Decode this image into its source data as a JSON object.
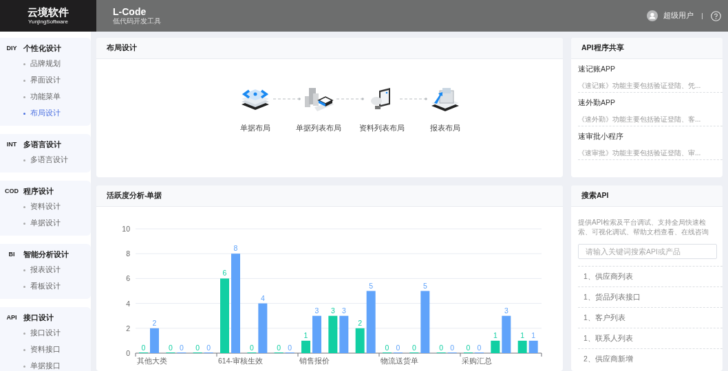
{
  "brand": {
    "name": "云境软件",
    "subtitle": "YunjingSoftware"
  },
  "app": {
    "title": "L-Code",
    "subtitle": "低代码开发工具"
  },
  "user": {
    "name": "超级用户"
  },
  "sidebar": {
    "groups": [
      {
        "code": "DIY",
        "title": "个性化设计",
        "items": [
          {
            "label": "品牌规划",
            "selected": false
          },
          {
            "label": "界面设计",
            "selected": false
          },
          {
            "label": "功能菜单",
            "selected": false
          },
          {
            "label": "布局设计",
            "selected": true
          }
        ]
      },
      {
        "code": "INT",
        "title": "多语言设计",
        "items": [
          {
            "label": "多语言设计",
            "selected": false
          }
        ]
      },
      {
        "code": "COD",
        "title": "程序设计",
        "items": [
          {
            "label": "资料设计",
            "selected": false
          },
          {
            "label": "单据设计",
            "selected": false
          }
        ]
      },
      {
        "code": "BI",
        "title": "智能分析设计",
        "items": [
          {
            "label": "报表设计",
            "selected": false
          },
          {
            "label": "看板设计",
            "selected": false
          }
        ]
      },
      {
        "code": "API",
        "title": "接口设计",
        "items": [
          {
            "label": "接口设计",
            "selected": false
          },
          {
            "label": "资料接口",
            "selected": false
          },
          {
            "label": "单据接口",
            "selected": false
          }
        ]
      }
    ]
  },
  "layout_panel": {
    "title": "布局设计",
    "steps": [
      {
        "kind": "stack",
        "label": "单据布局"
      },
      {
        "kind": "buildings",
        "label": "单据列表布局"
      },
      {
        "kind": "monitor",
        "label": "资料列表布局"
      },
      {
        "kind": "machine",
        "label": "报表布局"
      }
    ]
  },
  "activity_panel": {
    "title": "活跃度分析-单据",
    "chart_data": {
      "type": "bar",
      "categories": [
        "其他大类",
        null,
        null,
        "614-审核生效",
        null,
        null,
        "销售报价",
        null,
        null,
        "物流送货单",
        null,
        null,
        "采购汇总",
        null,
        null
      ],
      "series": [
        {
          "color": "#12cfa3",
          "values": [
            0,
            0,
            0,
            6,
            0,
            0,
            1,
            3,
            2,
            0,
            0,
            0,
            0,
            1,
            1
          ]
        },
        {
          "color": "#60a3fa",
          "values": [
            2,
            0,
            0,
            8,
            4,
            0,
            3,
            3,
            5,
            0,
            5,
            0,
            0,
            3,
            1
          ]
        }
      ],
      "ylim": [
        0,
        10
      ],
      "grid": true,
      "yticks": [
        0,
        2,
        4,
        6,
        8,
        10
      ],
      "data_labels": true
    }
  },
  "api_share": {
    "title": "API程序共享",
    "items": [
      {
        "name": "速记账APP",
        "description": "《速记账》功能主要包括验证登陆、凭..."
      },
      {
        "name": "速外勤APP",
        "description": "《速外勤》功能主要包括验证登陆、客..."
      },
      {
        "name": "速审批小程序",
        "description": "《速审批》功能主要包括验证登陆、审..."
      }
    ]
  },
  "api_search": {
    "title": "搜索API",
    "description": "提供API检索及平台调试、支持全局快速检索、可视化调试、帮助文档查看、在线咨询",
    "placeholder": "请输入关键词搜索API或产品",
    "results": [
      "1、供应商列表",
      "1、货品列表接口",
      "1、客户列表",
      "1、联系人列表",
      "2、供应商新增"
    ]
  }
}
